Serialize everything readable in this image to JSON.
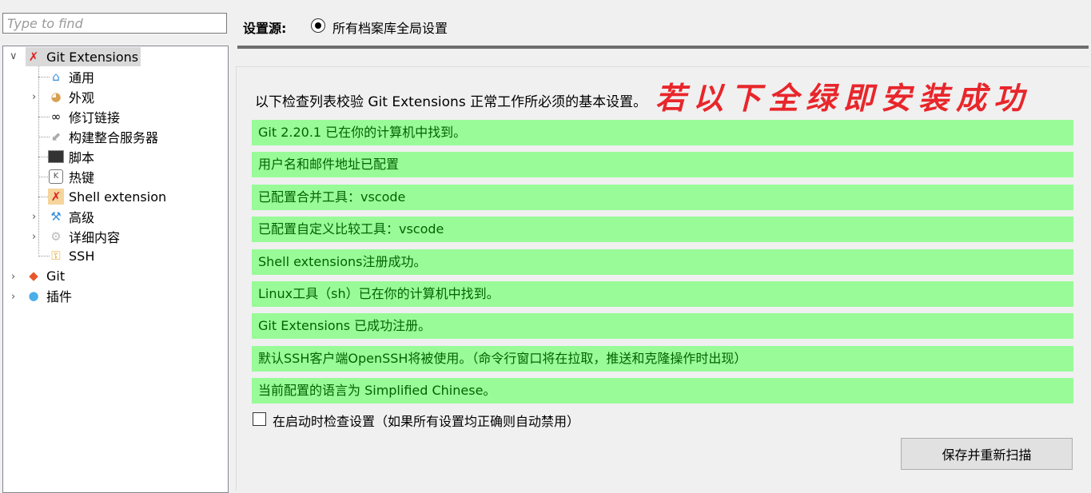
{
  "search": {
    "placeholder": "Type to find",
    "value": ""
  },
  "tree": {
    "root": {
      "label": "Git Extensions",
      "icon": "git-extensions-icon",
      "expanded": true,
      "selected": true
    },
    "children": [
      {
        "label": "通用",
        "icon": "home-icon",
        "expandable": false
      },
      {
        "label": "外观",
        "icon": "palette-icon",
        "expandable": true
      },
      {
        "label": "修订链接",
        "icon": "link-icon",
        "expandable": false
      },
      {
        "label": "构建整合服务器",
        "icon": "plug-icon",
        "expandable": false
      },
      {
        "label": "脚本",
        "icon": "terminal-icon",
        "expandable": false
      },
      {
        "label": "热键",
        "icon": "keyboard-key-icon",
        "expandable": false
      },
      {
        "label": "Shell extension",
        "icon": "shell-extension-icon",
        "expandable": false
      },
      {
        "label": "高级",
        "icon": "tools-icon",
        "expandable": true
      },
      {
        "label": "详细内容",
        "icon": "gear-icon",
        "expandable": true
      },
      {
        "label": "SSH",
        "icon": "key-icon",
        "expandable": false
      }
    ],
    "others": [
      {
        "label": "Git",
        "icon": "git-icon",
        "expandable": true
      },
      {
        "label": "插件",
        "icon": "puzzle-icon",
        "expandable": true
      }
    ]
  },
  "settings_source": {
    "label": "设置源:",
    "option": "所有档案库全局设置",
    "selected": true
  },
  "main": {
    "intro": "以下检查列表校验 Git Extensions 正常工作所必须的基本设置。",
    "annotation": "若以下全绿即安装成功",
    "checks": [
      "Git 2.20.1 已在你的计算机中找到。",
      "用户名和邮件地址已配置",
      "已配置合并工具：vscode",
      "已配置自定义比较工具：vscode",
      "Shell extensions注册成功。",
      "Linux工具（sh）已在你的计算机中找到。",
      "Git Extensions 已成功注册。",
      "默认SSH客户端OpenSSH将被使用。（命令行窗口将在拉取，推送和克隆操作时出现）",
      "当前配置的语言为 Simplified Chinese。"
    ],
    "check_on_startup": {
      "label": "在启动时检查设置（如果所有设置均正确则自动禁用）",
      "checked": false
    },
    "rescan_button": "保存并重新扫描"
  },
  "colors": {
    "ok_background": "#98fb98",
    "ok_text": "#006400",
    "annotation": "#e8262b"
  }
}
